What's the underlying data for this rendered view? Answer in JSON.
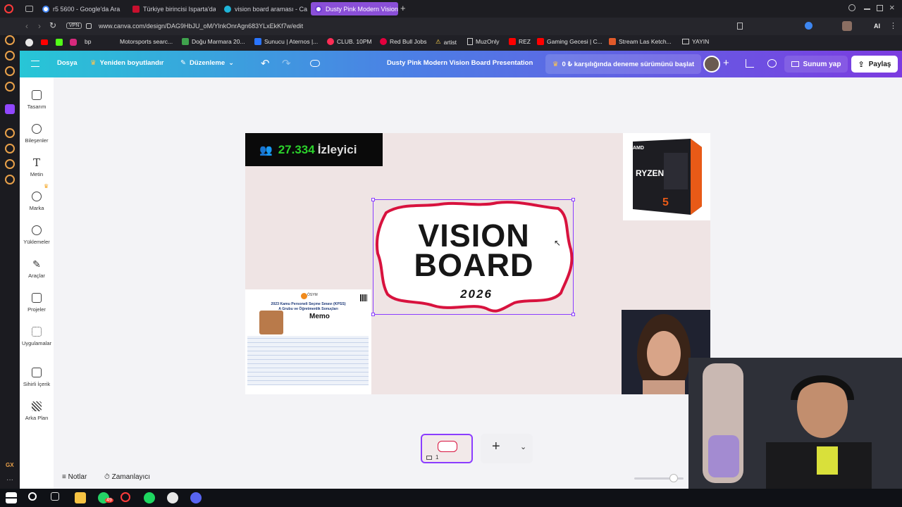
{
  "browser": {
    "tabs": [
      {
        "title": "r5 5600 - Google'da Ara"
      },
      {
        "title": "Türkiye birincisi Isparta'da"
      },
      {
        "title": "vision board araması - Ca"
      },
      {
        "title": "Dusty Pink Modern Vision"
      }
    ],
    "url": "www.canva.com/design/DAG9HbJU_oM/YlnkOnrAgn683YLxEkKf7w/edit",
    "vpn_label": "VPN",
    "ai_label": "AI",
    "bookmarks": [
      "bp",
      "Motorsports searc...",
      "Doğu Marmara 20...",
      "Sunucu | Aternos |...",
      "CLUB. 10PM",
      "Red Bull Jobs",
      "artist",
      "MuzOnly",
      "REZ",
      "Gaming Gecesi | C...",
      "Stream Las Ketch...",
      "YAYIN"
    ]
  },
  "canva_header": {
    "file": "Dosya",
    "resize": "Yeniden boyutlandır",
    "editing": "Düzenleme",
    "title": "Dusty Pink Modern Vision Board Presentation",
    "trial": "0 ₺ karşılığında deneme sürümünü başlat",
    "present": "Sunum yap",
    "share": "Paylaş"
  },
  "sidebar": {
    "items": [
      {
        "label": "Tasarım"
      },
      {
        "label": "Bileşenler"
      },
      {
        "label": "Metin"
      },
      {
        "label": "Marka"
      },
      {
        "label": "Yüklemeler"
      },
      {
        "label": "Araçlar"
      },
      {
        "label": "Projeler"
      },
      {
        "label": "Uygulamalar"
      },
      {
        "label": "Sihirli İçerik"
      },
      {
        "label": "Arka Plan"
      }
    ]
  },
  "canvas": {
    "viewer_count": "27.334",
    "viewer_label": "İzleyici",
    "vision_line1": "VISION",
    "vision_line2": "BOARD",
    "vision_year": "2026",
    "kpss_osym": "ÖSYM",
    "kpss_title": "2023 Kamu Personeli Seçme Sınavı (KPSS)",
    "kpss_subtitle": "A Grubu ve Öğretmenlik Sonuçları",
    "kpss_name": "Memo",
    "ryzen_brand": "AMD",
    "ryzen_name": "RYZEN",
    "ryzen_num": "5"
  },
  "bottom": {
    "page_number": "1",
    "notes": "Notlar",
    "timer": "Zamanlayıcı",
    "whatsapp_count": "49"
  },
  "colors": {
    "canva_gradient_start": "#27c6d6",
    "canva_gradient_end": "#7c3be0",
    "selection": "#8b3dff",
    "page_bg": "#efe4e4",
    "viewer_green": "#2bd12b"
  }
}
